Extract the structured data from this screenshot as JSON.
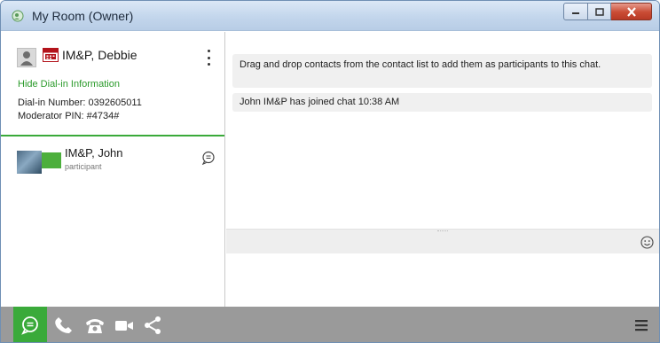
{
  "window": {
    "title": "My Room (Owner)"
  },
  "owner": {
    "name": "IM&P, Debbie",
    "hide_link": "Hide Dial-in Information",
    "dialin_number": "Dial-in Number: 0392605011",
    "moderator_pin": "Moderator PIN: #4734#"
  },
  "participants": [
    {
      "name": "IM&P, John",
      "role": "participant"
    }
  ],
  "messages": [
    "Drag and drop contacts from the contact list to add them as participants to this chat.",
    "John IM&P has joined chat 10:38 AM"
  ],
  "colors": {
    "accent_green": "#3aaa3a",
    "toolbar_gray": "#9a9a9a",
    "bubble_gray": "#f0f0f0"
  },
  "icons": {
    "app": "chat-app-icon",
    "toolbar": [
      "chat-icon",
      "phone-icon",
      "desk-phone-icon",
      "video-camera-icon",
      "share-icon",
      "menu-icon"
    ]
  }
}
